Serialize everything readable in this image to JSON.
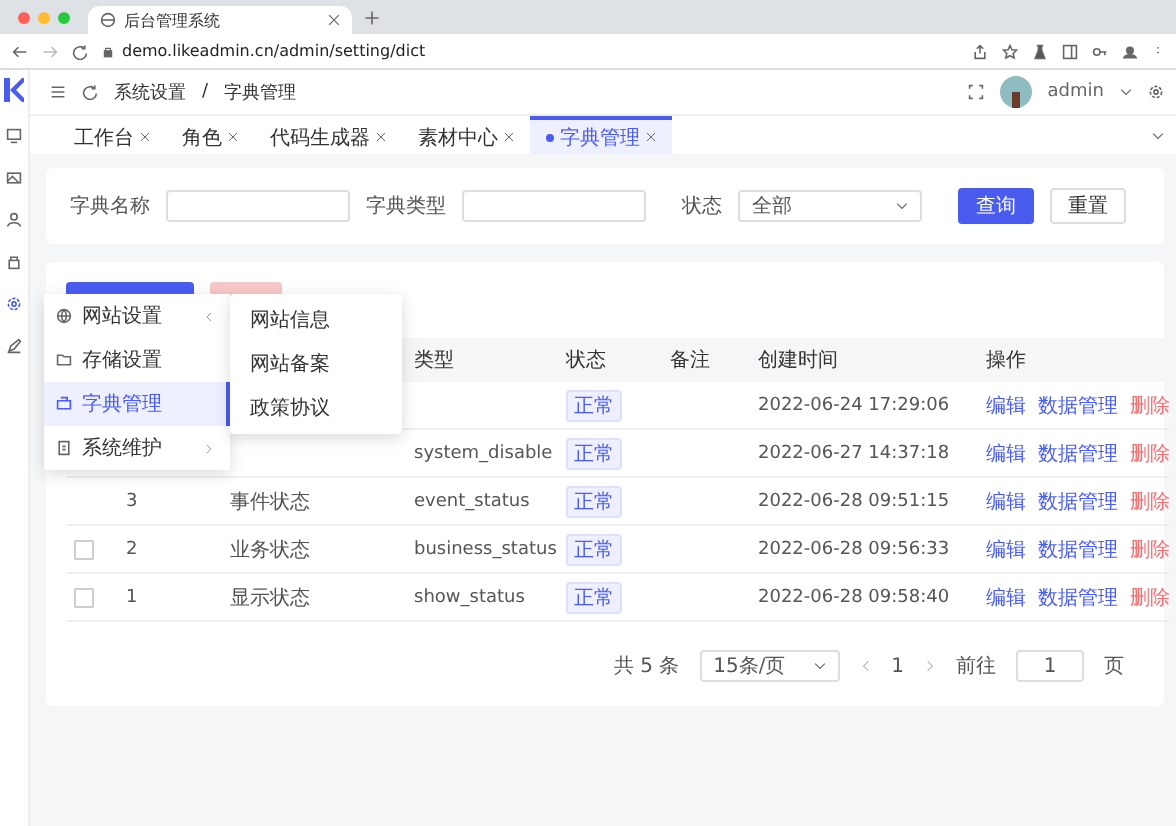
{
  "browser": {
    "tab_title": "后台管理系统",
    "url": "demo.likeadmin.cn/admin/setting/dict"
  },
  "header": {
    "breadcrumb": [
      "系统设置",
      "字典管理"
    ],
    "breadcrumb_separator": "/",
    "user": "admin"
  },
  "tabs": [
    {
      "label": "工作台",
      "selected": false
    },
    {
      "label": "角色",
      "selected": false
    },
    {
      "label": "代码生成器",
      "selected": false
    },
    {
      "label": "素材中心",
      "selected": false
    },
    {
      "label": "字典管理",
      "selected": true
    }
  ],
  "search": {
    "fields": [
      {
        "label": "字典名称"
      },
      {
        "label": "字典类型"
      }
    ],
    "status": {
      "label": "状态",
      "value": "全部"
    },
    "buttons": [
      {
        "label": "查询",
        "kind": "primary"
      },
      {
        "label": "重置",
        "kind": "plain"
      }
    ]
  },
  "table": {
    "columns": [
      "",
      "",
      "",
      "类型",
      "状态",
      "备注",
      "创建时间",
      "操作"
    ],
    "rows": [
      {
        "status": "正常",
        "created": "2022-06-24 17:29:06",
        "actions": [
          {
            "label": "编辑",
            "kind": "link"
          },
          {
            "label": "数据管理",
            "kind": "link"
          },
          {
            "label": "删除",
            "kind": "danger"
          }
        ]
      },
      {
        "type": "system_disable",
        "status": "正常",
        "created": "2022-06-27 14:37:18",
        "actions": [
          {
            "label": "编辑",
            "kind": "link"
          },
          {
            "label": "数据管理",
            "kind": "link"
          },
          {
            "label": "删除",
            "kind": "danger"
          }
        ]
      },
      {
        "id": "3",
        "name": "事件状态",
        "type": "event_status",
        "status": "正常",
        "created": "2022-06-28 09:51:15",
        "actions": [
          {
            "label": "编辑",
            "kind": "link"
          },
          {
            "label": "数据管理",
            "kind": "link"
          },
          {
            "label": "删除",
            "kind": "danger"
          }
        ]
      },
      {
        "checked": false,
        "id": "2",
        "name": "业务状态",
        "type": "business_status",
        "status": "正常",
        "created": "2022-06-28 09:56:33",
        "actions": [
          {
            "label": "编辑",
            "kind": "link"
          },
          {
            "label": "数据管理",
            "kind": "link"
          },
          {
            "label": "删除",
            "kind": "danger"
          }
        ]
      },
      {
        "checked": false,
        "id": "1",
        "name": "显示状态",
        "type": "show_status",
        "status": "正常",
        "created": "2022-06-28 09:58:40",
        "actions": [
          {
            "label": "编辑",
            "kind": "link"
          },
          {
            "label": "数据管理",
            "kind": "link"
          },
          {
            "label": "删除",
            "kind": "danger"
          }
        ]
      }
    ]
  },
  "pagination": {
    "total": "共 5 条",
    "page_size": "15条/页",
    "page": "1",
    "goto": "前往",
    "goto_value": "1",
    "unit": "页"
  },
  "menu": {
    "items": [
      {
        "label": "网站设置",
        "selected": false,
        "expanded": true,
        "has_children": true
      },
      {
        "label": "存储设置",
        "selected": false,
        "has_children": false
      },
      {
        "label": "字典管理",
        "selected": true,
        "has_children": false
      },
      {
        "label": "系统维护",
        "selected": false,
        "expanded": false,
        "has_children": true
      }
    ],
    "submenu": [
      "网站信息",
      "网站备案",
      "政策协议"
    ]
  }
}
